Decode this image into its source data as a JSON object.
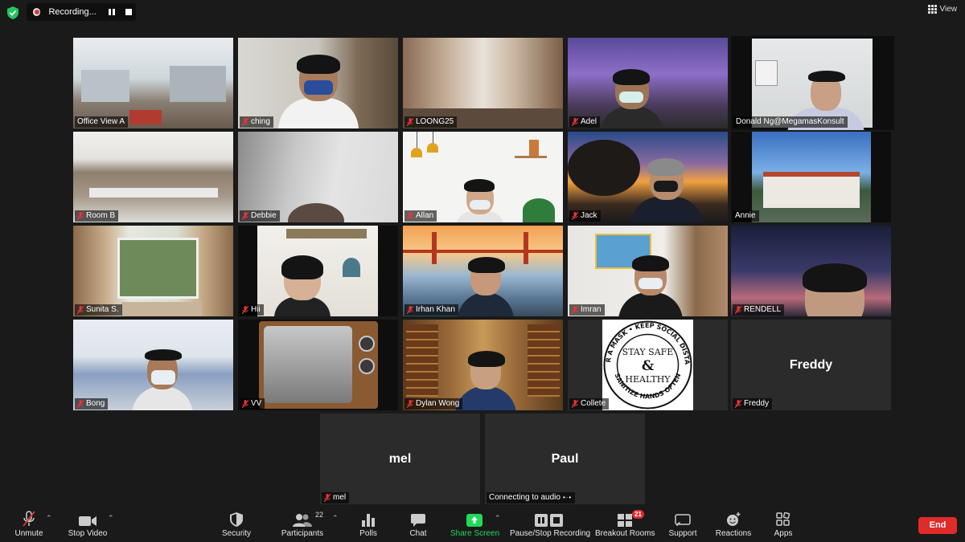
{
  "top": {
    "recording_label": "Recording...",
    "view_label": "View"
  },
  "tiles": {
    "office_view_a": "Office View A",
    "ching": "ching",
    "loong25": "LOONG25",
    "adel": "Adel",
    "donald": "Donald Ng@MegamasKonsult",
    "room_b": "Room B",
    "debbie": "Debbie",
    "allan": "Allan",
    "jack": "Jack",
    "annie": "Annie",
    "sunita": "Sunita S.",
    "hii": "Hii",
    "irhan": "Irhan Khan",
    "imran": "Imran",
    "rendell": "RENDELL",
    "bong": "Bong",
    "vv": "VV",
    "dylan": "Dylan Wong",
    "collete": "Collete",
    "freddy": "Freddy",
    "freddy_big": "Freddy",
    "mel": "mel",
    "mel_big": "mel",
    "paul_big": "Paul",
    "paul_status": "Connecting to audio"
  },
  "sign": {
    "line1": "STAY SAFE",
    "line2": "&",
    "line3": "HEALTHY",
    "top_ring": "WEAR A MASK • KEEP SOCIAL DISTANCE",
    "bottom_ring": "SANITIZE HANDS OFTEN"
  },
  "toolbar": {
    "unmute": "Unmute",
    "stop_video": "Stop Video",
    "security": "Security",
    "participants": "Participants",
    "participants_count": "22",
    "polls": "Polls",
    "chat": "Chat",
    "share_screen": "Share Screen",
    "pause_stop_recording": "Pause/Stop Recording",
    "breakout_rooms": "Breakout Rooms",
    "breakout_count": "21",
    "support": "Support",
    "reactions": "Reactions",
    "apps": "Apps",
    "end": "End"
  },
  "colors": {
    "active_speaker": "#d7e35a",
    "end_button": "#e02b2b",
    "share_screen": "#23d959"
  }
}
